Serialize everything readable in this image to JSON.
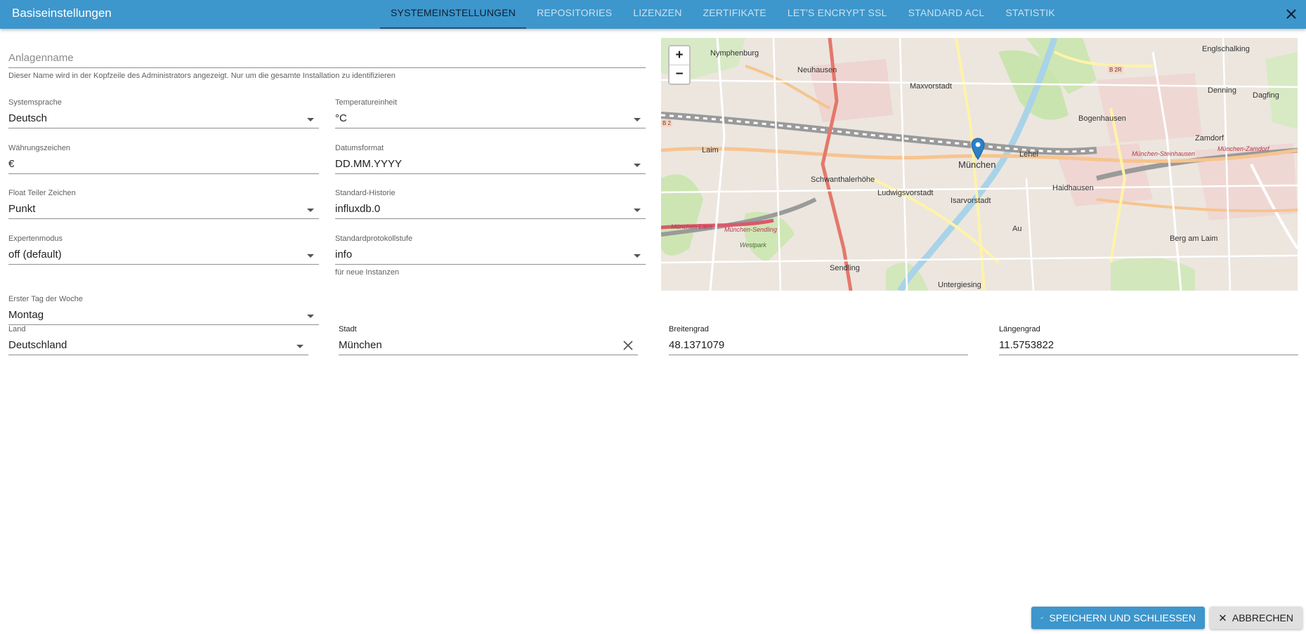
{
  "dialog": {
    "title": "Basiseinstellungen",
    "tabs": [
      {
        "label": "SYSTEMEINSTELLUNGEN",
        "active": true
      },
      {
        "label": "REPOSITORIES"
      },
      {
        "label": "LIZENZEN"
      },
      {
        "label": "ZERTIFIKATE"
      },
      {
        "label": "LET'S ENCRYPT SSL"
      },
      {
        "label": "STANDARD ACL"
      },
      {
        "label": "STATISTIK"
      }
    ],
    "close_icon": "close-icon"
  },
  "form": {
    "site_name": {
      "placeholder": "Anlagenname",
      "value": "",
      "helper": "Dieser Name wird in der Kopfzeile des Administrators angezeigt. Nur um die gesamte Installation zu identifizieren"
    },
    "system_language": {
      "label": "Systemsprache",
      "value": "Deutsch"
    },
    "temperature_unit": {
      "label": "Temperatureinheit",
      "value": "°C"
    },
    "currency": {
      "label": "Währungszeichen",
      "value": "€"
    },
    "date_format": {
      "label": "Datumsformat",
      "value": "DD.MM.YYYY"
    },
    "float_separator": {
      "label": "Float Teiler Zeichen",
      "value": "Punkt"
    },
    "default_history": {
      "label": "Standard-Historie",
      "value": "influxdb.0"
    },
    "expert_mode": {
      "label": "Expertenmodus",
      "value": "off (default)"
    },
    "default_log_level": {
      "label": "Standardprotokollstufe",
      "value": "info",
      "helper": "für neue Instanzen"
    },
    "first_day": {
      "label": "Erster Tag der Woche",
      "value": "Montag"
    },
    "country": {
      "label": "Land",
      "value": "Deutschland"
    },
    "city": {
      "label": "Stadt",
      "value": "München"
    },
    "latitude": {
      "label": "Breitengrad",
      "value": "48.1371079"
    },
    "longitude": {
      "label": "Längengrad",
      "value": "11.5753822"
    }
  },
  "map": {
    "zoom_in": "+",
    "zoom_out": "−",
    "marker_label": "München",
    "place_labels": [
      "Nymphenburg",
      "Neuhausen",
      "Maxvorstadt",
      "Englschalking",
      "Denning",
      "Dagfing",
      "Bogenhausen",
      "Zamdorf",
      "Laim",
      "Schwanthalerhöhe",
      "Ludwigsvorstadt",
      "Isarvorstadt",
      "Lehel",
      "Haidhausen",
      "Au",
      "Berg am Laim",
      "Sendling",
      "Untergiesing",
      "München-Sendling",
      "Westpark",
      "München Laim",
      "München-Steinhausen",
      "München-Zamdorf",
      "B 2R",
      "B 2"
    ]
  },
  "actions": {
    "save_label": "SPEICHERN UND SCHLIESSEN",
    "cancel_label": "ABBRECHEN",
    "save_icon": "check-icon",
    "cancel_icon": "close-icon"
  },
  "colors": {
    "appbar": "#3d96cc",
    "tab_active_text": "#0b1f33",
    "primary_button": "#3d96cc",
    "secondary_button": "#e0e0e0",
    "map_marker": "#2a81cb"
  }
}
